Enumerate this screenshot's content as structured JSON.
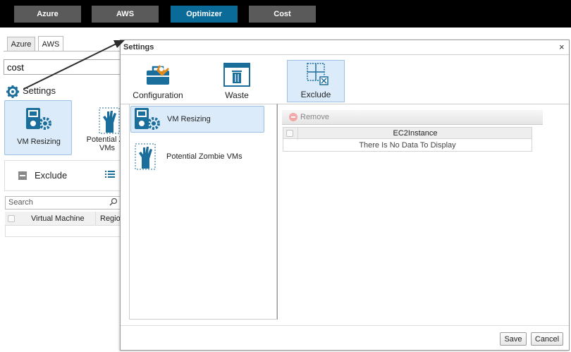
{
  "topnav": {
    "items": [
      {
        "label": "Azure"
      },
      {
        "label": "AWS"
      },
      {
        "label": "Optimizer",
        "active": true
      },
      {
        "label": "Cost"
      }
    ]
  },
  "background": {
    "tabs": [
      {
        "label": "Azure"
      },
      {
        "label": "AWS"
      }
    ],
    "search_value": "cost",
    "settings_title": "Settings",
    "cards": [
      {
        "label": "VM Resizing"
      },
      {
        "label": "Potential Zo\nVMs"
      }
    ],
    "exclude_label": "Exclude",
    "grid_search_placeholder": "Search",
    "grid_columns": [
      "Virtual Machine",
      "Regio"
    ]
  },
  "dialog": {
    "title": "Settings",
    "close_glyph": "×",
    "ribbon": [
      {
        "label": "Configuration",
        "icon": "toolbox-icon"
      },
      {
        "label": "Waste",
        "icon": "trash-window-icon"
      },
      {
        "label": "Exclude",
        "icon": "exclude-grid-icon",
        "active": true
      }
    ],
    "list": [
      {
        "label": "VM Resizing",
        "icon": "vm-resize-icon",
        "active": true
      },
      {
        "label": "Potential Zombie VMs",
        "icon": "zombie-hand-icon"
      }
    ],
    "toolbar": {
      "remove_label": "Remove"
    },
    "grid": {
      "column": "EC2Instance",
      "empty_text": "There Is No Data To Display"
    },
    "footer": {
      "save": "Save",
      "cancel": "Cancel"
    }
  },
  "colors": {
    "accent": "#0a6a98",
    "selected_bg": "#dcebfa",
    "selected_border": "#9cc0e4",
    "icon_blue": "#1a6e9b"
  }
}
